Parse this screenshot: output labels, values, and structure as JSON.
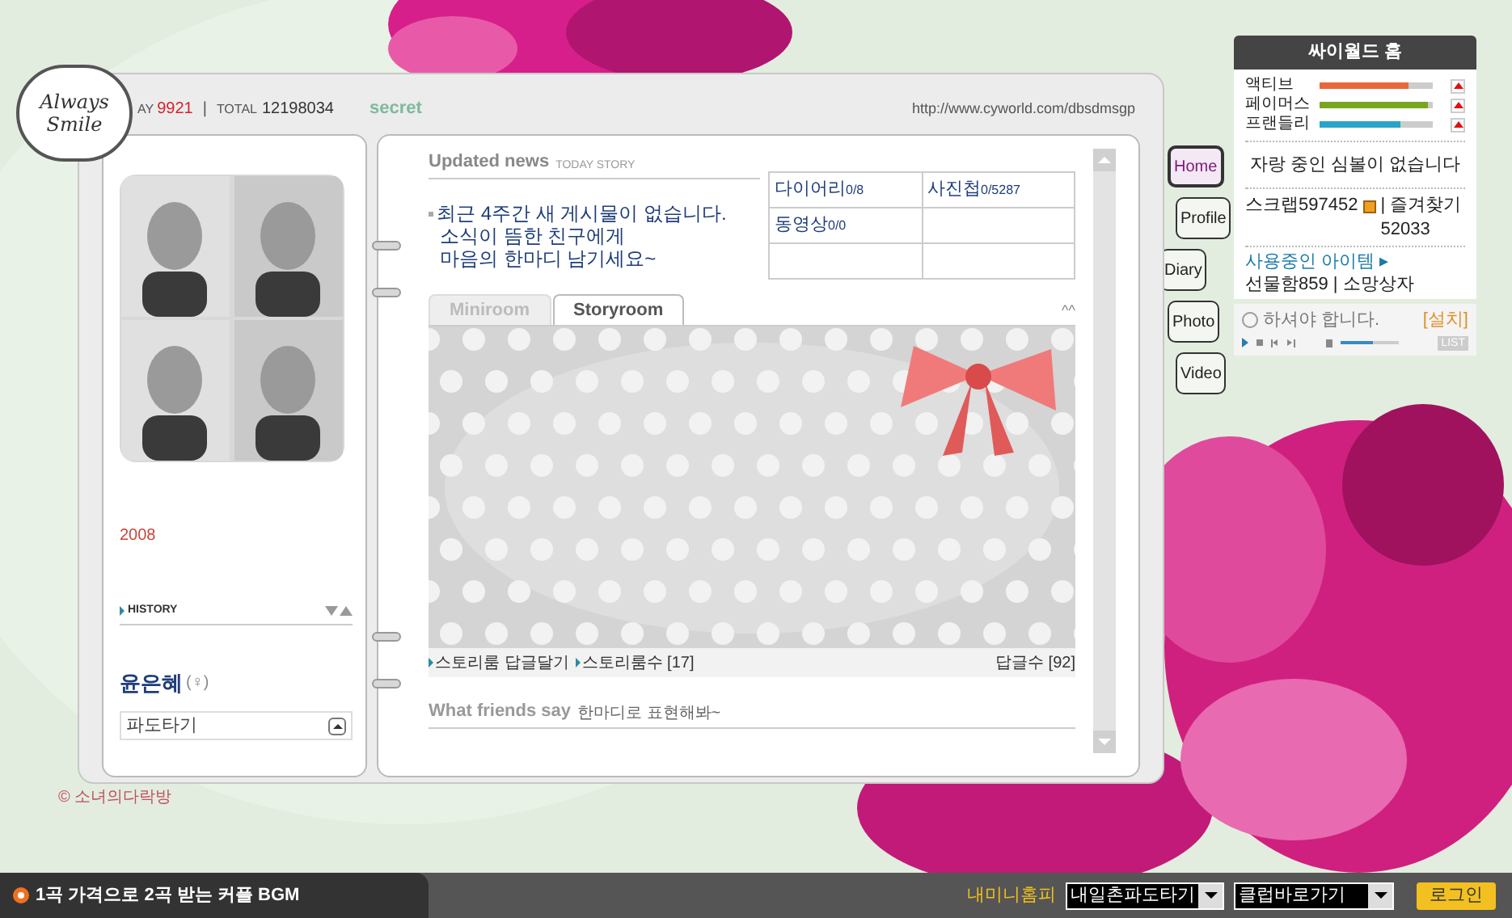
{
  "badge": {
    "line_1": "Always",
    "line_2": "Smile"
  },
  "counter": {
    "today_label": "AY",
    "today": "9921",
    "separator": "|",
    "total_label": "TOTAL",
    "total": "12198034"
  },
  "secret": "secret",
  "url": "http://www.cyworld.com/dbsdmsgp",
  "profile": {
    "year": "2008",
    "history": "HISTORY",
    "name": "윤은혜",
    "gender": "(♀)",
    "wave_select": "파도타기"
  },
  "updated_news": {
    "title": "Updated news",
    "subtitle": "TODAY STORY",
    "message": [
      "최근 4주간 새 게시물이 없습니다.",
      "소식이 뜸한 친구에게",
      "마음의 한마디 남기세요~"
    ],
    "stats": [
      {
        "label": "다이어리",
        "count": "0/8"
      },
      {
        "label": "사진첩",
        "count": "0/5287"
      },
      {
        "label": "동영상",
        "count": "0/0"
      }
    ]
  },
  "room_tabs": [
    {
      "label": "Miniroom",
      "selected": false
    },
    {
      "label": "Storyroom",
      "selected": true
    }
  ],
  "collapse": "^^",
  "story_footer": {
    "reply_link": "스토리룸 답글달기",
    "count_link": "스토리룸수 [17]",
    "replies": "답글수 [92]"
  },
  "friends_say": {
    "title": "What friends say",
    "subtitle": "한마디로 표현해봐~"
  },
  "nav_tabs": [
    {
      "label": "Home",
      "selected": true
    },
    {
      "label": "Profile",
      "selected": false
    },
    {
      "label": "Diary",
      "selected": false
    },
    {
      "label": "Photo",
      "selected": false
    },
    {
      "label": "Video",
      "selected": false
    }
  ],
  "cyworld_home": {
    "title": "싸이월드 홈",
    "meters": [
      {
        "label": "액티브",
        "level": 0.78,
        "color": "#e8683a"
      },
      {
        "label": "페이머스",
        "level": 0.95,
        "color": "#7aa61e"
      },
      {
        "label": "프랜들리",
        "level": 0.72,
        "color": "#2aa3c8"
      }
    ],
    "symbol_message": "자랑 중인 심볼이 없습니다",
    "scrap": "스크랩597452",
    "favorites": "| 즐겨찾기52033",
    "items_link": "사용중인 아이템 ▸",
    "gift": "선물함859",
    "wish": "| 소망상자"
  },
  "player": {
    "message": "하셔야 합니다.",
    "install": "[설치]",
    "volume": {
      "level": 0.55
    },
    "list": "LIST"
  },
  "copyright": "© 소녀의다락방",
  "bottom_bar": {
    "bgm": "1곡 가격으로 2곡 받는 커플 BGM",
    "my_home": "내미니홈피",
    "ilchon_select": "내일촌파도타기",
    "club_select": "클럽바로가기",
    "login": "로그인"
  }
}
